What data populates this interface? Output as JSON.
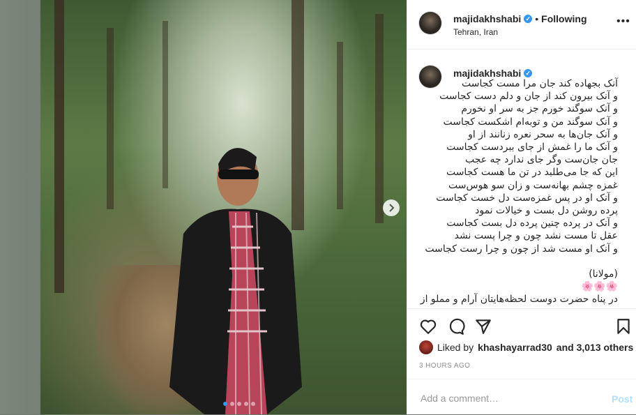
{
  "post": {
    "username": "majidakhshabi",
    "verified_mark": "✓",
    "separator": "•",
    "follow_status": "Following",
    "location": "Tehran, Iran",
    "more_icon": "more-horizontal-icon",
    "caption_lines": [
      "آنک بجهاده کند جان مرا مست کجاست",
      "و آنک بیرون کند از جان و دلم دست کجاست",
      "و آنک سوگند خورم جز به سر او نخورم",
      "و آنک سوگند من و توبه‌ام اشکست کجاست",
      "و آنک جان‌ها به سحر نعره زنانند از او",
      "و آنک ما را غمش از جای ببردست کجاست",
      "جان جان‌ست وگر جای ندارد چه عجب",
      "این که جا می‌طلبد در تن ما هست کجاست",
      "غمزه چشم بهانه‌ست و زان سو هوس‌ست",
      "و آنک او در پس غمزه‌ست دل خست کجاست",
      "پرده روشن دل بست و خیالات نمود",
      "و آنک در پرده چنین پرده دل بست کجاست",
      "عقل تا مست نشد چون و چرا پست نشد",
      "و آنک او مست شد از چون و چرا رست کجاست",
      "",
      "(مولانا)",
      "🌸🌸🌸",
      "در پناه حضرت دوست لحظه‌هایتان آرام و مملو از"
    ],
    "likes_prefix": "Liked by",
    "liked_by_user": "khashayarrad30",
    "likes_suffix": "and 3,013 others",
    "timestamp": "3 HOURS AGO",
    "comment_placeholder": "Add a comment…",
    "post_button": "Post",
    "carousel_count": 5,
    "carousel_active": 1
  },
  "colors": {
    "accent": "#3897f0",
    "post_disabled": "#b2dffc",
    "text": "#262626",
    "muted": "#8e8e8e"
  }
}
